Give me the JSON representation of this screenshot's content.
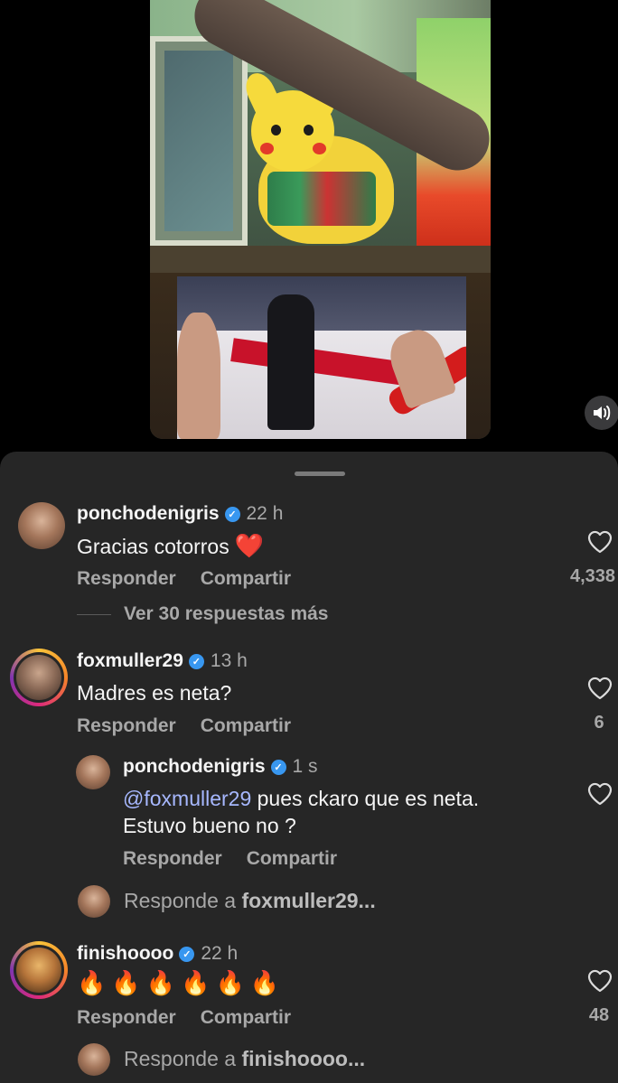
{
  "video": {
    "sound_icon": "speaker-icon"
  },
  "comments": [
    {
      "username": "ponchodenigris",
      "verified": true,
      "time": "22 h",
      "text": "Gracias cotorros",
      "emoji": "❤️",
      "reply_label": "Responder",
      "share_label": "Compartir",
      "likes": "4,338",
      "view_replies": "Ver 30 respuestas más"
    },
    {
      "username": "foxmuller29",
      "verified": true,
      "time": "13 h",
      "text": "Madres es neta?",
      "reply_label": "Responder",
      "share_label": "Compartir",
      "likes": "6",
      "replies": [
        {
          "username": "ponchodenigris",
          "verified": true,
          "time": "1 s",
          "mention": "@foxmuller29",
          "text_line1": " pues ckaro que es neta.",
          "text_line2": "Estuvo bueno no ?",
          "reply_label": "Responder",
          "share_label": "Compartir"
        }
      ],
      "reply_prompt_prefix": "Responde a ",
      "reply_prompt_user": "foxmuller29..."
    },
    {
      "username": "finishoooo",
      "verified": true,
      "time": "22 h",
      "text": "🔥🔥🔥🔥🔥🔥",
      "reply_label": "Responder",
      "share_label": "Compartir",
      "likes": "48",
      "reply_prompt_prefix": "Responde a ",
      "reply_prompt_user": "finishoooo..."
    }
  ],
  "colors": {
    "sheet_bg": "#262626",
    "verified_blue": "#3897f0",
    "mention": "#a7b8ff",
    "secondary_text": "#a8a8a8"
  }
}
